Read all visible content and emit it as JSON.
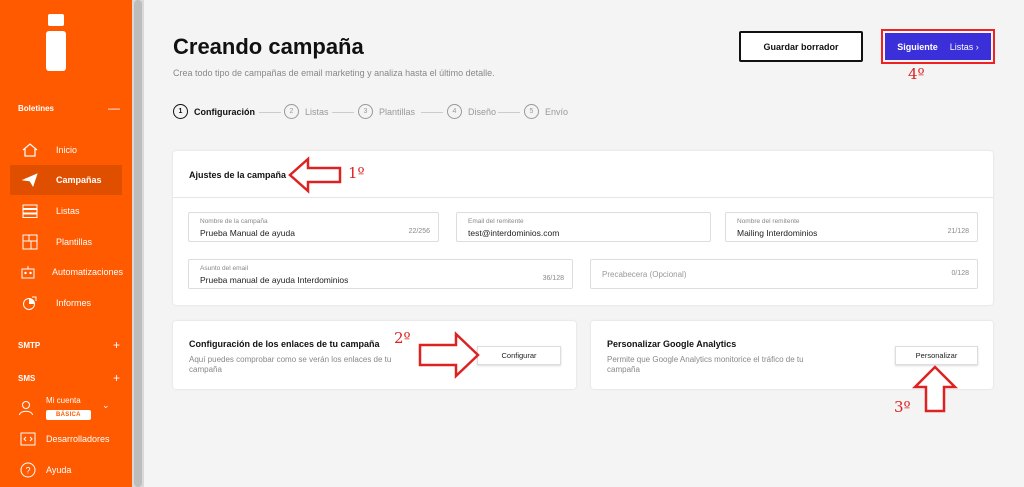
{
  "sidebar": {
    "sections": {
      "boletines": {
        "label": "Boletines",
        "sign": "—"
      },
      "smtp": {
        "label": "SMTP",
        "sign": "+"
      },
      "sms": {
        "label": "SMS",
        "sign": "+"
      }
    },
    "items": [
      {
        "label": "Inicio",
        "icon": "home-icon"
      },
      {
        "label": "Campañas",
        "icon": "paper-plane-icon"
      },
      {
        "label": "Listas",
        "icon": "list-icon"
      },
      {
        "label": "Plantillas",
        "icon": "template-icon"
      },
      {
        "label": "Automatizaciones",
        "icon": "robot-icon"
      },
      {
        "label": "Informes",
        "icon": "chart-icon"
      }
    ],
    "account": {
      "label": "Mi cuenta",
      "badge": "BÁSICA"
    },
    "bottom": [
      {
        "label": "Desarrolladores",
        "icon": "code-icon"
      },
      {
        "label": "Ayuda",
        "icon": "help-icon"
      }
    ]
  },
  "header": {
    "title": "Creando campaña",
    "subtitle": "Crea todo tipo de campañas de email marketing y analiza hasta el último detalle.",
    "save_draft": "Guardar borrador",
    "next_bold": "Siguiente",
    "next_target": "Listas ›"
  },
  "steps": [
    {
      "num": "1",
      "label": "Configuración"
    },
    {
      "num": "2",
      "label": "Listas"
    },
    {
      "num": "3",
      "label": "Plantillas"
    },
    {
      "num": "4",
      "label": "Diseño"
    },
    {
      "num": "5",
      "label": "Envío"
    }
  ],
  "settings": {
    "title": "Ajustes de la campaña",
    "fields": {
      "campaign_name": {
        "label": "Nombre de la campaña",
        "value": "Prueba Manual de ayuda",
        "count": "22/256"
      },
      "sender_email": {
        "label": "Email del remitente",
        "value": "test@interdominios.com"
      },
      "sender_name": {
        "label": "Nombre del remitente",
        "value": "Mailing Interdominios",
        "count": "21/128"
      },
      "subject": {
        "label": "Asunto del email",
        "value": "Prueba manual de ayuda Interdominios",
        "count": "36/128"
      },
      "preheader": {
        "placeholder": "Precabecera (Opcional)",
        "count": "0/128"
      }
    }
  },
  "links_card": {
    "title": "Configuración de los enlaces de tu campaña",
    "desc_1": "Aquí puedes comprobar como se verán los enlaces de tu",
    "desc_2": "campaña",
    "button": "Configurar"
  },
  "analytics_card": {
    "title": "Personalizar Google Analytics",
    "desc_1": "Permite que Google Analytics monitorice el tráfico de tu",
    "desc_2": "campaña",
    "button": "Personalizar"
  },
  "annotations": {
    "a1": "1º",
    "a2": "2º",
    "a3": "3º",
    "a4": "4º",
    "color": "#dd2222"
  },
  "colors": {
    "sidebar": "#ff5a00",
    "primary": "#3b2fd9"
  }
}
